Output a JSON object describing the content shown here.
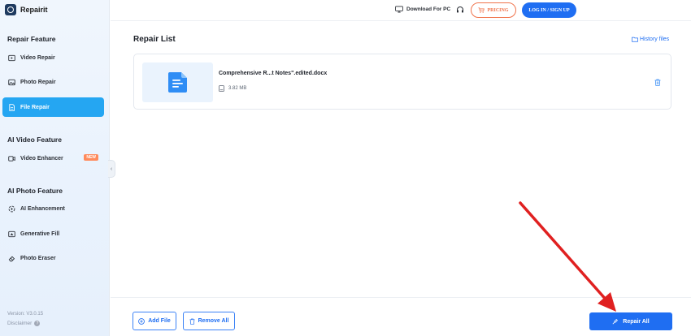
{
  "brand": {
    "name": "Repairit"
  },
  "sidebar": {
    "sections": [
      {
        "title": "Repair Feature"
      },
      {
        "title": "AI Video Feature"
      },
      {
        "title": "AI Photo Feature"
      }
    ],
    "items": [
      {
        "label": "Video Repair",
        "icon": "video-repair-icon"
      },
      {
        "label": "Photo Repair",
        "icon": "photo-repair-icon"
      },
      {
        "label": "File Repair",
        "icon": "file-repair-icon",
        "active": true
      },
      {
        "label": "Video Enhancer",
        "icon": "video-enhancer-icon",
        "badge": "NEW"
      },
      {
        "label": "AI Enhancement",
        "icon": "ai-enhancement-icon"
      },
      {
        "label": "Generative Fill",
        "icon": "generative-fill-icon"
      },
      {
        "label": "Photo Eraser",
        "icon": "photo-eraser-icon"
      }
    ],
    "version": "Version: V3.0.15",
    "disclaimer": "Disclaimer"
  },
  "topbar": {
    "download": "Download For PC",
    "pricing": "PRICING",
    "login": "LOG IN / SIGN UP"
  },
  "main": {
    "title": "Repair List",
    "history": "History files",
    "file": {
      "name": "Comprehensive R...t Notes\".edited.docx",
      "size": "3.82 MB"
    }
  },
  "footer": {
    "add_file": "Add File",
    "remove_all": "Remove All",
    "repair_all": "Repair All"
  },
  "colors": {
    "accent": "#1f6ef2",
    "active_item": "#25a6f2",
    "pricing": "#f0734b",
    "annotation_arrow": "#e02020"
  }
}
